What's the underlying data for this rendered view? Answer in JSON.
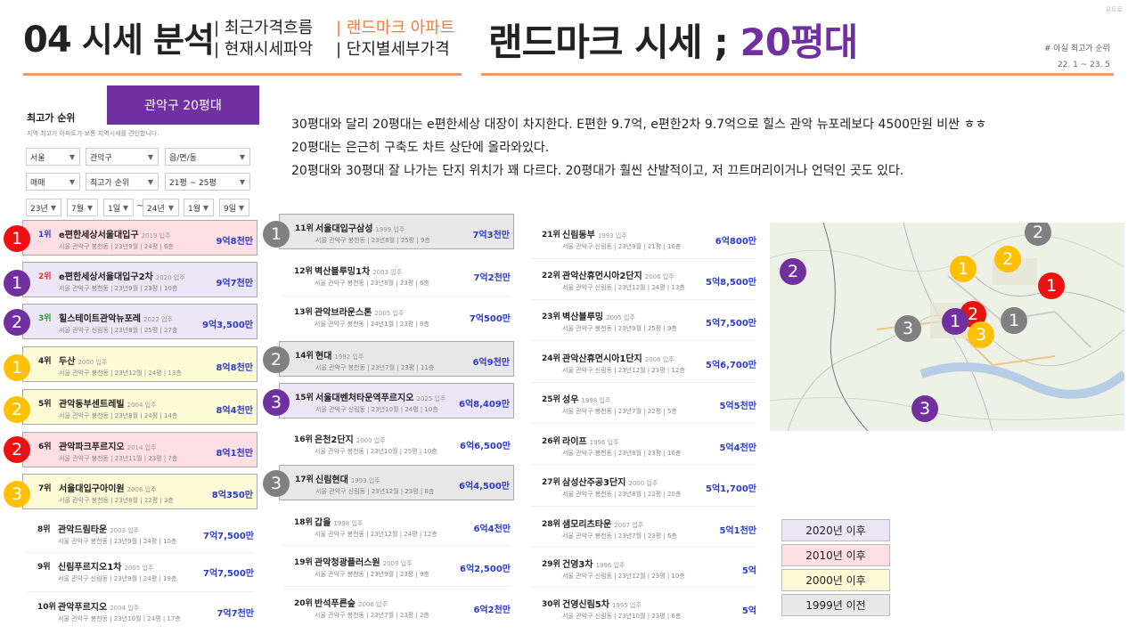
{
  "header": {
    "section_num": "04",
    "section_title": "시세 분석",
    "sub1": [
      "| 최근가격흐름",
      "| 현재시세파악"
    ],
    "sub2": [
      "| 랜드마크 아파트",
      "| 단지별세부가격"
    ],
    "title_main": "랜드마크 시세 ; ",
    "title_accent": "20평대",
    "note_line1": "# 아실 최고가 순위",
    "note_line2": "22. 1 ~ 23. 5",
    "watermark": "유트로"
  },
  "panel": {
    "tag": "관악구 20평대",
    "rank_title": "최고가 순위",
    "rank_desc": "지역 최고가 아파트가 보통 지역시세를 견인합니다.",
    "filters_row1": [
      "서울",
      "관악구",
      "읍/면/동"
    ],
    "filters_row2": [
      "매매",
      "최고가 순위",
      "21평 ~ 25평"
    ],
    "filters_row3": [
      "23년",
      "7월",
      "1일",
      "24년",
      "1월",
      "9일"
    ],
    "tilde": "~"
  },
  "columns": [
    {
      "items": [
        {
          "rank": "1위",
          "name": "e편한세상서울대입구",
          "year": "2019 입주",
          "addr": "서울 관악구 봉천동 | 23년9월 | 24평 | 6층",
          "price": "9억8천만"
        },
        {
          "rank": "2위",
          "name": "e편한세상서울대입구2차",
          "year": "2020 입주",
          "addr": "서울 관악구 봉천동 | 23년9월 | 23평 | 10층",
          "price": "9억7천만"
        },
        {
          "rank": "3위",
          "name": "힐스테이트관악뉴포레",
          "year": "2022 입주",
          "addr": "서울 관악구 신림동 | 23년8월 | 25평 | 27층",
          "price": "9억3,500만"
        },
        {
          "rank": "4위",
          "name": "두산",
          "year": "2000 입주",
          "addr": "서울 관악구 봉천동 | 23년12월 | 24평 | 13층",
          "price": "8억8천만"
        },
        {
          "rank": "5위",
          "name": "관악동부센트레빌",
          "year": "2004 입주",
          "addr": "서울 관악구 봉천동 | 23년8월 | 24평 | 14층",
          "price": "8억4천만"
        },
        {
          "rank": "6위",
          "name": "관악파크푸르지오",
          "year": "2014 입주",
          "addr": "서울 관악구 봉천동 | 23년11월 | 23평 | 7층",
          "price": "8억1천만"
        },
        {
          "rank": "7위",
          "name": "서울대입구아이원",
          "year": "2006 입주",
          "addr": "서울 관악구 봉천동 | 23년8월 | 22평 | 3층",
          "price": "8억350만"
        },
        {
          "rank": "8위",
          "name": "관악드림타운",
          "year": "2003 입주",
          "addr": "서울 관악구 봉천동 | 23년9월 | 24평 | 10층",
          "price": "7억7,500만"
        },
        {
          "rank": "9위",
          "name": "신림푸르지오1차",
          "year": "2005 입주",
          "addr": "서울 관악구 신림동 | 23년9월 | 24평 | 19층",
          "price": "7억7,500만"
        },
        {
          "rank": "10위",
          "name": "관악푸르지오",
          "year": "2004 입주",
          "addr": "서울 관악구 봉천동 | 23년10월 | 24평 | 17층",
          "price": "7억7천만"
        }
      ]
    },
    {
      "items": [
        {
          "rank": "11위",
          "name": "서울대입구삼성",
          "year": "1999 입주",
          "addr": "서울 관악구 봉천동 | 23년8월 | 25평 | 9층",
          "price": "7억3천만"
        },
        {
          "rank": "12위",
          "name": "벽산블루밍1차",
          "year": "2003 입주",
          "addr": "서울 관악구 봉천동 | 23년8월 | 23평 | 6층",
          "price": "7억2천만"
        },
        {
          "rank": "13위",
          "name": "관악브라운스톤",
          "year": "2005 입주",
          "addr": "서울 관악구 봉천동 | 24년1월 | 23평 | 8층",
          "price": "7억500만"
        },
        {
          "rank": "14위",
          "name": "현대",
          "year": "1992 입주",
          "addr": "서울 관악구 봉천동 | 23년7월 | 23평 | 11층",
          "price": "6억9천만"
        },
        {
          "rank": "15위",
          "name": "서울대벤처타운역푸르지오",
          "year": "2025 입주",
          "addr": "서울 관악구 신림동 | 23년10월 | 24평 | 10층",
          "price": "6억8,409만"
        },
        {
          "rank": "16위",
          "name": "은천2단지",
          "year": "2000 입주",
          "addr": "서울 관악구 봉천동 | 23년10월 | 25평 | 10층",
          "price": "6억6,500만"
        },
        {
          "rank": "17위",
          "name": "신림현대",
          "year": "1993 입주",
          "addr": "서울 관악구 신림동 | 23년12월 | 23평 | 8층",
          "price": "6억4,500만"
        },
        {
          "rank": "18위",
          "name": "갑을",
          "year": "1998 입주",
          "addr": "서울 관악구 봉천동 | 23년12월 | 24평 | 12층",
          "price": "6억4천만"
        },
        {
          "rank": "19위",
          "name": "관악청광플러스원",
          "year": "2009 입주",
          "addr": "서울 관악구 봉천동 | 23년9월 | 23평 | 9층",
          "price": "6억2,500만"
        },
        {
          "rank": "20위",
          "name": "반석푸른숲",
          "year": "2006 입주",
          "addr": "서울 관악구 봉천동 | 23년7월 | 23평 | 2층",
          "price": "6억2천만"
        }
      ]
    },
    {
      "items": [
        {
          "rank": "21위",
          "name": "신림동부",
          "year": "1993 입주",
          "addr": "서울 관악구 신림동 | 23년9월 | 21평 | 16층",
          "price": "6억800만"
        },
        {
          "rank": "22위",
          "name": "관악산휴먼시아2단지",
          "year": "2006 입주",
          "addr": "서울 관악구 신림동 | 23년12월 | 24평 | 13층",
          "price": "5억8,500만"
        },
        {
          "rank": "23위",
          "name": "벽산블루밍",
          "year": "2005 입주",
          "addr": "서울 관악구 봉천동 | 23년9월 | 25평 | 9층",
          "price": "5억7,500만"
        },
        {
          "rank": "24위",
          "name": "관악산휴먼시아1단지",
          "year": "2006 입주",
          "addr": "서울 관악구 신림동 | 23년12월 | 23평 | 12층",
          "price": "5억6,700만"
        },
        {
          "rank": "25위",
          "name": "성우",
          "year": "1998 입주",
          "addr": "서울 관악구 봉천동 | 23년7월 | 22평 | 5층",
          "price": "5억5천만"
        },
        {
          "rank": "26위",
          "name": "라이프",
          "year": "1996 입주",
          "addr": "서울 관악구 봉천동 | 23년8월 | 23평 | 16층",
          "price": "5억4천만"
        },
        {
          "rank": "27위",
          "name": "삼성산주공3단지",
          "year": "2000 입주",
          "addr": "서울 관악구 봉천동 | 23년8월 | 22평 | 20층",
          "price": "5억1,700만"
        },
        {
          "rank": "28위",
          "name": "샘모리츠타운",
          "year": "2007 입주",
          "addr": "서울 관악구 봉천동 | 23년7월 | 23평 | 6층",
          "price": "5억1천만"
        },
        {
          "rank": "29위",
          "name": "건영3차",
          "year": "1996 입주",
          "addr": "서울 관악구 신림동 | 23년12월 | 23평 | 10층",
          "price": "5억"
        },
        {
          "rank": "30위",
          "name": "건영신림5차",
          "year": "1995 입주",
          "addr": "서울 관악구 신림동 | 23년10월 | 23평 | 6층",
          "price": "5억"
        }
      ]
    }
  ],
  "badges": {
    "col1": [
      "1",
      "1",
      "2",
      "1",
      "2",
      "2",
      "3"
    ],
    "col2": [
      "1",
      "2",
      "3",
      "3"
    ],
    "map": [
      "2",
      "2",
      "1",
      "2",
      "1",
      "2",
      "3",
      "1",
      "3",
      "1",
      "3"
    ]
  },
  "description": [
    "30평대와 달리 20평대는 e편한세상 대장이 차지한다. E편한 9.7억,  e편한2차 9.7억으로 힐스 관악 뉴포레보다 4500만원 비싼 ㅎㅎ",
    "20평대는 은근히 구축도 차트 상단에 올라와있다.",
    "20평대와 30평대 잘 나가는 단지 위치가 꽤 다르다. 20평대가 훨씬 산발적이고, 저 끄트머리이거나 언덕인 곳도 있다."
  ],
  "legend": [
    "2020년 이후",
    "2010년 이후",
    "2000년 이후",
    "1999년 이전"
  ],
  "colors": {
    "purple": "#7030a0",
    "red": "#ee1111",
    "yellow": "#ffc000",
    "gray": "#808080",
    "orange": "#f07a3a",
    "price_blue": "#2a3acb"
  }
}
